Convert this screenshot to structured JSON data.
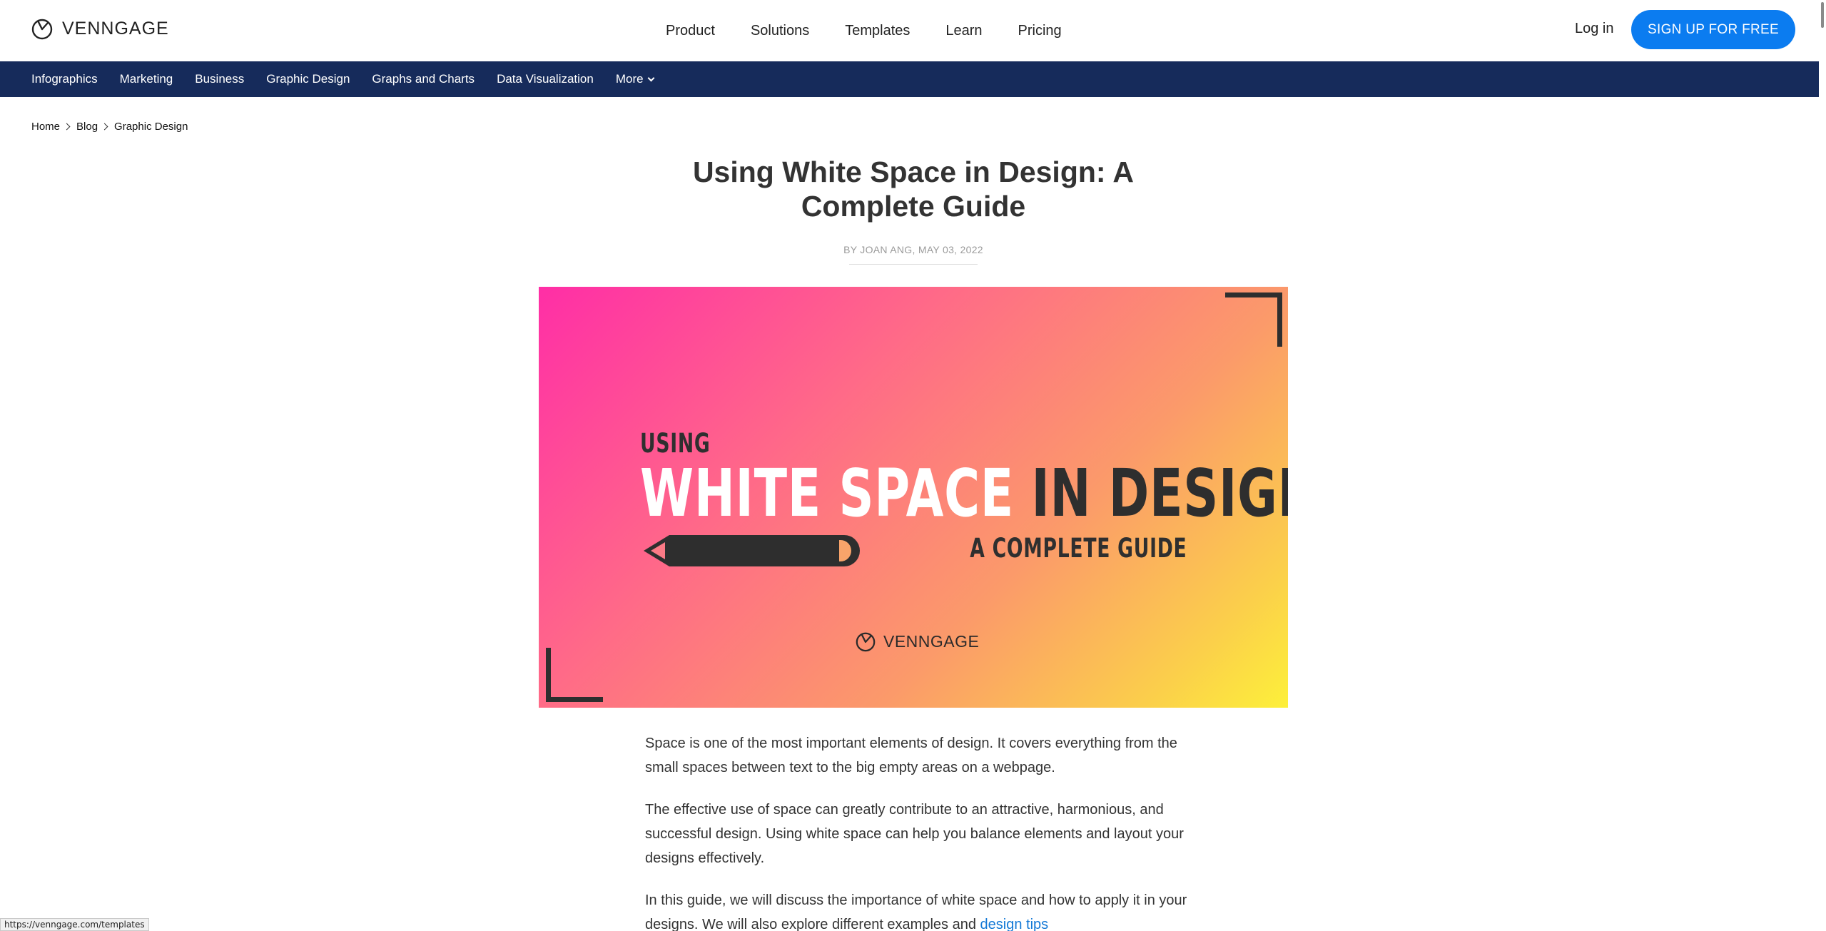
{
  "header": {
    "brand": "VENNGAGE",
    "nav": [
      "Product",
      "Solutions",
      "Templates",
      "Learn",
      "Pricing"
    ],
    "login": "Log in",
    "signup": "SIGN UP FOR FREE"
  },
  "subnav": {
    "items": [
      "Infographics",
      "Marketing",
      "Business",
      "Graphic Design",
      "Graphs and Charts",
      "Data Visualization"
    ],
    "more": "More"
  },
  "breadcrumb": [
    "Home",
    "Blog",
    "Graphic Design"
  ],
  "article": {
    "title": "Using White Space in Design: A Complete Guide",
    "byline": "BY JOAN ANG, MAY 03, 2022",
    "hero": {
      "line1": "USING",
      "headline_white": "WHITE SPACE",
      "headline_dark": " IN DESIGN",
      "line3": "A COMPLETE GUIDE",
      "brand": "VENNGAGE"
    },
    "paragraphs": [
      "Space is one of the most important elements of design. It covers everything from the small spaces between text to the big empty areas on a webpage.",
      "The effective use of space can greatly contribute to an attractive, harmonious, and successful design. Using white space can help you balance elements and layout your designs effectively."
    ],
    "p3_text": "In this guide, we will discuss the importance of white space and how to apply it in your designs. We will also explore different examples and ",
    "p3_link": "design tips"
  },
  "status_url": "https://venngage.com/templates",
  "colors": {
    "brand_blue": "#0b7cf0",
    "subnav_bg": "#162b5b",
    "link": "#1479d6"
  }
}
